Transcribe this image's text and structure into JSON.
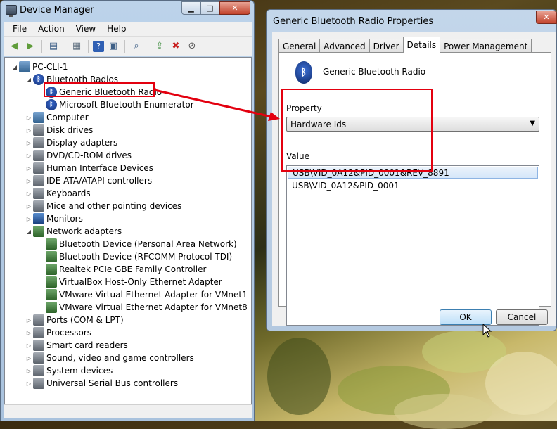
{
  "device_manager": {
    "title": "Device Manager",
    "caption_buttons": [
      "minimize",
      "maximize",
      "close"
    ],
    "menu": [
      "File",
      "Action",
      "View",
      "Help"
    ],
    "toolbar_icons": [
      "back-icon",
      "forward-icon",
      "show-hide-console-tree-icon",
      "properties-icon",
      "help-icon",
      "view-icon",
      "scan-hardware-icon",
      "update-driver-icon",
      "uninstall-icon",
      "disable-icon"
    ],
    "tree": {
      "root": "PC-CLI-1",
      "items": [
        {
          "label": "Bluetooth Radios",
          "level": 1,
          "expanded": true,
          "icon": "bluetooth-icon"
        },
        {
          "label": "Generic Bluetooth Radio",
          "level": 2,
          "icon": "bluetooth-icon"
        },
        {
          "label": "Microsoft Bluetooth Enumerator",
          "level": 2,
          "icon": "bluetooth-icon"
        },
        {
          "label": "Computer",
          "level": 1,
          "icon": "computer-icon"
        },
        {
          "label": "Disk drives",
          "level": 1,
          "icon": "disk-icon"
        },
        {
          "label": "Display adapters",
          "level": 1,
          "icon": "display-icon"
        },
        {
          "label": "DVD/CD-ROM drives",
          "level": 1,
          "icon": "dvd-icon"
        },
        {
          "label": "Human Interface Devices",
          "level": 1,
          "icon": "hid-icon"
        },
        {
          "label": "IDE ATA/ATAPI controllers",
          "level": 1,
          "icon": "ide-icon"
        },
        {
          "label": "Keyboards",
          "level": 1,
          "icon": "keyboard-icon"
        },
        {
          "label": "Mice and other pointing devices",
          "level": 1,
          "icon": "mouse-icon"
        },
        {
          "label": "Monitors",
          "level": 1,
          "icon": "monitor-icon"
        },
        {
          "label": "Network adapters",
          "level": 1,
          "expanded": true,
          "icon": "network-icon"
        },
        {
          "label": "Bluetooth Device (Personal Area Network)",
          "level": 2,
          "icon": "network-icon"
        },
        {
          "label": "Bluetooth Device (RFCOMM Protocol TDI)",
          "level": 2,
          "icon": "network-icon"
        },
        {
          "label": "Realtek PCIe GBE Family Controller",
          "level": 2,
          "icon": "network-icon"
        },
        {
          "label": "VirtualBox Host-Only Ethernet Adapter",
          "level": 2,
          "icon": "network-icon"
        },
        {
          "label": "VMware Virtual Ethernet Adapter for VMnet1",
          "level": 2,
          "icon": "network-icon"
        },
        {
          "label": "VMware Virtual Ethernet Adapter for VMnet8",
          "level": 2,
          "icon": "network-icon"
        },
        {
          "label": "Ports (COM & LPT)",
          "level": 1,
          "icon": "port-icon"
        },
        {
          "label": "Processors",
          "level": 1,
          "icon": "processor-icon"
        },
        {
          "label": "Smart card readers",
          "level": 1,
          "icon": "smartcard-icon"
        },
        {
          "label": "Sound, video and game controllers",
          "level": 1,
          "icon": "sound-icon"
        },
        {
          "label": "System devices",
          "level": 1,
          "icon": "system-icon"
        },
        {
          "label": "Universal Serial Bus controllers",
          "level": 1,
          "icon": "usb-icon"
        }
      ]
    }
  },
  "properties_dialog": {
    "title": "Generic Bluetooth Radio Properties",
    "tabs": [
      "General",
      "Advanced",
      "Driver",
      "Details",
      "Power Management"
    ],
    "active_tab": "Details",
    "device_name": "Generic Bluetooth Radio",
    "property_label": "Property",
    "property_selected": "Hardware Ids",
    "value_label": "Value",
    "values": [
      "USB\\VID_0A12&PID_0001&REV_8891",
      "USB\\VID_0A12&PID_0001"
    ],
    "ok_label": "OK",
    "cancel_label": "Cancel"
  },
  "colors": {
    "annotation_red": "#e3000f",
    "selection_blue": "#d5e6f9"
  }
}
